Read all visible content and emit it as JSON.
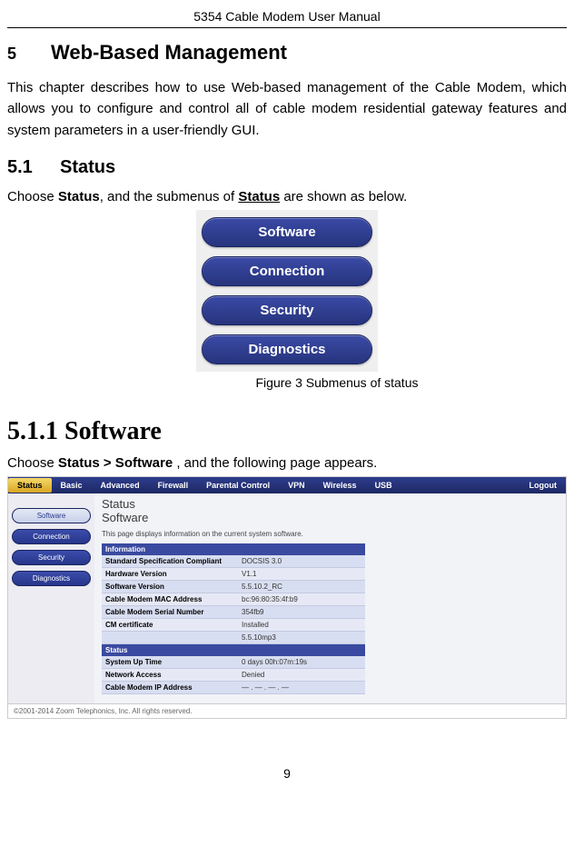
{
  "header": {
    "title": "5354 Cable Modem User Manual"
  },
  "sec5": {
    "num": "5",
    "title": "Web-Based Management",
    "para": "This chapter describes how to use Web-based management of the Cable Modem, which allows you to configure and control all of cable modem residential gateway features and system parameters in a user-friendly GUI."
  },
  "sec51": {
    "num": "5.1",
    "title": "Status",
    "intro_pre": "Choose ",
    "intro_b1": "Status",
    "intro_mid": ", and the submenus of ",
    "intro_u": "Status",
    "intro_post": " are shown as below.",
    "caption": "Figure 3 Submenus of status"
  },
  "submenu": {
    "items": [
      "Software",
      "Connection",
      "Security",
      "Diagnostics"
    ]
  },
  "sec511": {
    "title": "5.1.1  Software",
    "intro_pre": "Choose ",
    "intro_b": "Status > Software",
    "intro_post": " , and the following page appears."
  },
  "swshot": {
    "topnav": [
      "Status",
      "Basic",
      "Advanced",
      "Firewall",
      "Parental Control",
      "VPN",
      "Wireless",
      "USB",
      "Logout"
    ],
    "side": [
      "Software",
      "Connection",
      "Security",
      "Diagnostics"
    ],
    "crumb": "Status",
    "sub": "Software",
    "desc": "This page displays information on the current system software.",
    "info_head": "Information",
    "info_rows": [
      {
        "lbl": "Standard Specification Compliant",
        "val": "DOCSIS 3.0"
      },
      {
        "lbl": "Hardware Version",
        "val": "V1.1"
      },
      {
        "lbl": "Software Version",
        "val": "5.5.10.2_RC"
      },
      {
        "lbl": "Cable Modem MAC Address",
        "val": "bc:96:80:35:4f:b9"
      },
      {
        "lbl": "Cable Modem Serial Number",
        "val": "354fb9"
      },
      {
        "lbl": "CM certificate",
        "val": "Installed"
      },
      {
        "lbl": "",
        "val": "5.5.10mp3"
      }
    ],
    "status_head": "Status",
    "status_rows": [
      {
        "lbl": "System Up Time",
        "val": "0 days 00h:07m:19s"
      },
      {
        "lbl": "Network Access",
        "val": "Denied"
      },
      {
        "lbl": "Cable Modem IP Address",
        "val": "— . — . — . —"
      }
    ],
    "footer": "©2001-2014 Zoom Telephonics, Inc. All rights reserved."
  },
  "page_number": "9"
}
